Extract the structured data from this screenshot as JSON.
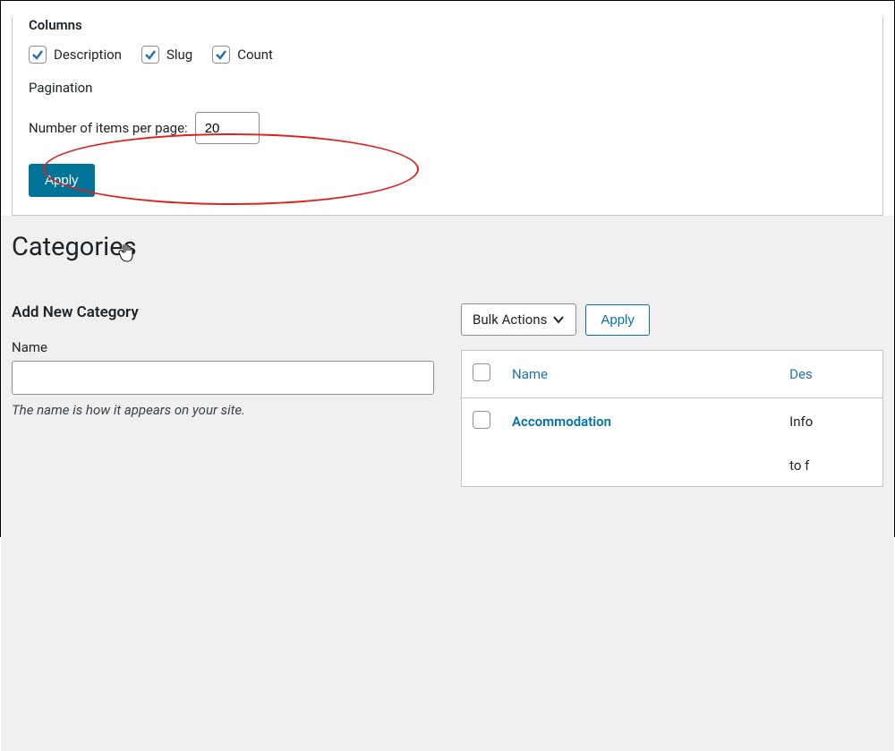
{
  "screen_options": {
    "columns_heading": "Columns",
    "columns": [
      {
        "key": "description",
        "label": "Description",
        "checked": true
      },
      {
        "key": "slug",
        "label": "Slug",
        "checked": true
      },
      {
        "key": "count",
        "label": "Count",
        "checked": true
      }
    ],
    "pagination_heading": "Pagination",
    "items_label": "Number of items per page:",
    "items_value": "20",
    "apply_label": "Apply"
  },
  "page": {
    "title": "Categories"
  },
  "add_form": {
    "heading": "Add New Category",
    "name_label": "Name",
    "name_value": "",
    "name_help": "The name is how it appears on your site."
  },
  "bulk": {
    "selected": "Bulk Actions",
    "apply_label": "Apply"
  },
  "table": {
    "headers": {
      "name": "Name",
      "description": "Des"
    },
    "rows": [
      {
        "name": "Accommodation",
        "description": "Info"
      }
    ],
    "extra_row": "to f"
  },
  "annotation": {
    "ellipse_color": "#e0201c"
  }
}
